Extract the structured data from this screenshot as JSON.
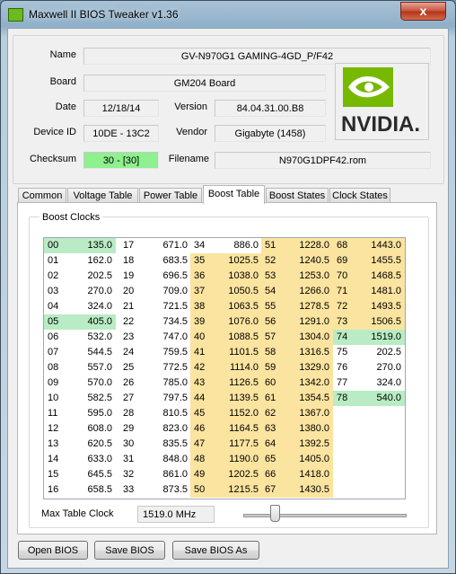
{
  "window": {
    "title": "Maxwell II BIOS Tweaker v1.36",
    "close_glyph": "x"
  },
  "info": {
    "name_label": "Name",
    "name_value": "GV-N970G1 GAMING-4GD_P/F42",
    "board_label": "Board",
    "board_value": "GM204 Board",
    "date_label": "Date",
    "date_value": "12/18/14",
    "version_label": "Version",
    "version_value": "84.04.31.00.B8",
    "device_label": "Device ID",
    "device_value": "10DE - 13C2",
    "vendor_label": "Vendor",
    "vendor_value": "Gigabyte (1458)",
    "checksum_label": "Checksum",
    "checksum_value": "30 - [30]",
    "filename_label": "Filename",
    "filename_value": "N970G1DPF42.rom",
    "logo_text": "NVIDIA."
  },
  "tabs": [
    {
      "label": "Common"
    },
    {
      "label": "Voltage Table"
    },
    {
      "label": "Power Table"
    },
    {
      "label": "Boost Table",
      "active": true
    },
    {
      "label": "Boost States"
    },
    {
      "label": "Clock States"
    }
  ],
  "boost": {
    "group_title": "Boost Clocks",
    "columns": [
      [
        [
          "00",
          "135.0",
          "green"
        ],
        [
          "01",
          "162.0",
          ""
        ],
        [
          "02",
          "202.5",
          ""
        ],
        [
          "03",
          "270.0",
          ""
        ],
        [
          "04",
          "324.0",
          ""
        ],
        [
          "05",
          "405.0",
          "green"
        ],
        [
          "06",
          "532.0",
          ""
        ],
        [
          "07",
          "544.5",
          ""
        ],
        [
          "08",
          "557.0",
          ""
        ],
        [
          "09",
          "570.0",
          ""
        ],
        [
          "10",
          "582.5",
          ""
        ],
        [
          "11",
          "595.0",
          ""
        ],
        [
          "12",
          "608.0",
          ""
        ],
        [
          "13",
          "620.5",
          ""
        ],
        [
          "14",
          "633.0",
          ""
        ],
        [
          "15",
          "645.5",
          ""
        ],
        [
          "16",
          "658.5",
          ""
        ]
      ],
      [
        [
          "17",
          "671.0",
          ""
        ],
        [
          "18",
          "683.5",
          ""
        ],
        [
          "19",
          "696.5",
          ""
        ],
        [
          "20",
          "709.0",
          ""
        ],
        [
          "21",
          "721.5",
          ""
        ],
        [
          "22",
          "734.5",
          ""
        ],
        [
          "23",
          "747.0",
          ""
        ],
        [
          "24",
          "759.5",
          ""
        ],
        [
          "25",
          "772.5",
          ""
        ],
        [
          "26",
          "785.0",
          ""
        ],
        [
          "27",
          "797.5",
          ""
        ],
        [
          "28",
          "810.5",
          ""
        ],
        [
          "29",
          "823.0",
          ""
        ],
        [
          "30",
          "835.5",
          ""
        ],
        [
          "31",
          "848.0",
          ""
        ],
        [
          "32",
          "861.0",
          ""
        ],
        [
          "33",
          "873.5",
          ""
        ]
      ],
      [
        [
          "34",
          "886.0",
          ""
        ],
        [
          "35",
          "1025.5",
          "yellow"
        ],
        [
          "36",
          "1038.0",
          "yellow"
        ],
        [
          "37",
          "1050.5",
          "yellow"
        ],
        [
          "38",
          "1063.5",
          "yellow"
        ],
        [
          "39",
          "1076.0",
          "yellow"
        ],
        [
          "40",
          "1088.5",
          "yellow"
        ],
        [
          "41",
          "1101.5",
          "yellow"
        ],
        [
          "42",
          "1114.0",
          "yellow"
        ],
        [
          "43",
          "1126.5",
          "yellow"
        ],
        [
          "44",
          "1139.5",
          "yellow"
        ],
        [
          "45",
          "1152.0",
          "yellow"
        ],
        [
          "46",
          "1164.5",
          "yellow"
        ],
        [
          "47",
          "1177.5",
          "yellow"
        ],
        [
          "48",
          "1190.0",
          "yellow"
        ],
        [
          "49",
          "1202.5",
          "yellow"
        ],
        [
          "50",
          "1215.5",
          "yellow"
        ]
      ],
      [
        [
          "51",
          "1228.0",
          "yellow"
        ],
        [
          "52",
          "1240.5",
          "yellow"
        ],
        [
          "53",
          "1253.0",
          "yellow"
        ],
        [
          "54",
          "1266.0",
          "yellow"
        ],
        [
          "55",
          "1278.5",
          "yellow"
        ],
        [
          "56",
          "1291.0",
          "yellow"
        ],
        [
          "57",
          "1304.0",
          "yellow"
        ],
        [
          "58",
          "1316.5",
          "yellow"
        ],
        [
          "59",
          "1329.0",
          "yellow"
        ],
        [
          "60",
          "1342.0",
          "yellow"
        ],
        [
          "61",
          "1354.5",
          "yellow"
        ],
        [
          "62",
          "1367.0",
          "yellow"
        ],
        [
          "63",
          "1380.0",
          "yellow"
        ],
        [
          "64",
          "1392.5",
          "yellow"
        ],
        [
          "65",
          "1405.0",
          "yellow"
        ],
        [
          "66",
          "1418.0",
          "yellow"
        ],
        [
          "67",
          "1430.5",
          "yellow"
        ]
      ],
      [
        [
          "68",
          "1443.0",
          "yellow"
        ],
        [
          "69",
          "1455.5",
          "yellow"
        ],
        [
          "70",
          "1468.5",
          "yellow"
        ],
        [
          "71",
          "1481.0",
          "yellow"
        ],
        [
          "72",
          "1493.5",
          "yellow"
        ],
        [
          "73",
          "1506.5",
          "yellow"
        ],
        [
          "74",
          "1519.0",
          "green"
        ],
        [
          "75",
          "202.5",
          ""
        ],
        [
          "76",
          "270.0",
          ""
        ],
        [
          "77",
          "324.0",
          ""
        ],
        [
          "78",
          "540.0",
          "green"
        ]
      ]
    ],
    "max_label": "Max Table Clock",
    "max_value": "1519.0 MHz"
  },
  "buttons": {
    "open": "Open BIOS",
    "save": "Save BIOS",
    "save_as": "Save BIOS As"
  },
  "colors": {
    "yellow": "#fbe49f",
    "green": "#b9ecc4",
    "accent_green": "#8ef08e"
  }
}
